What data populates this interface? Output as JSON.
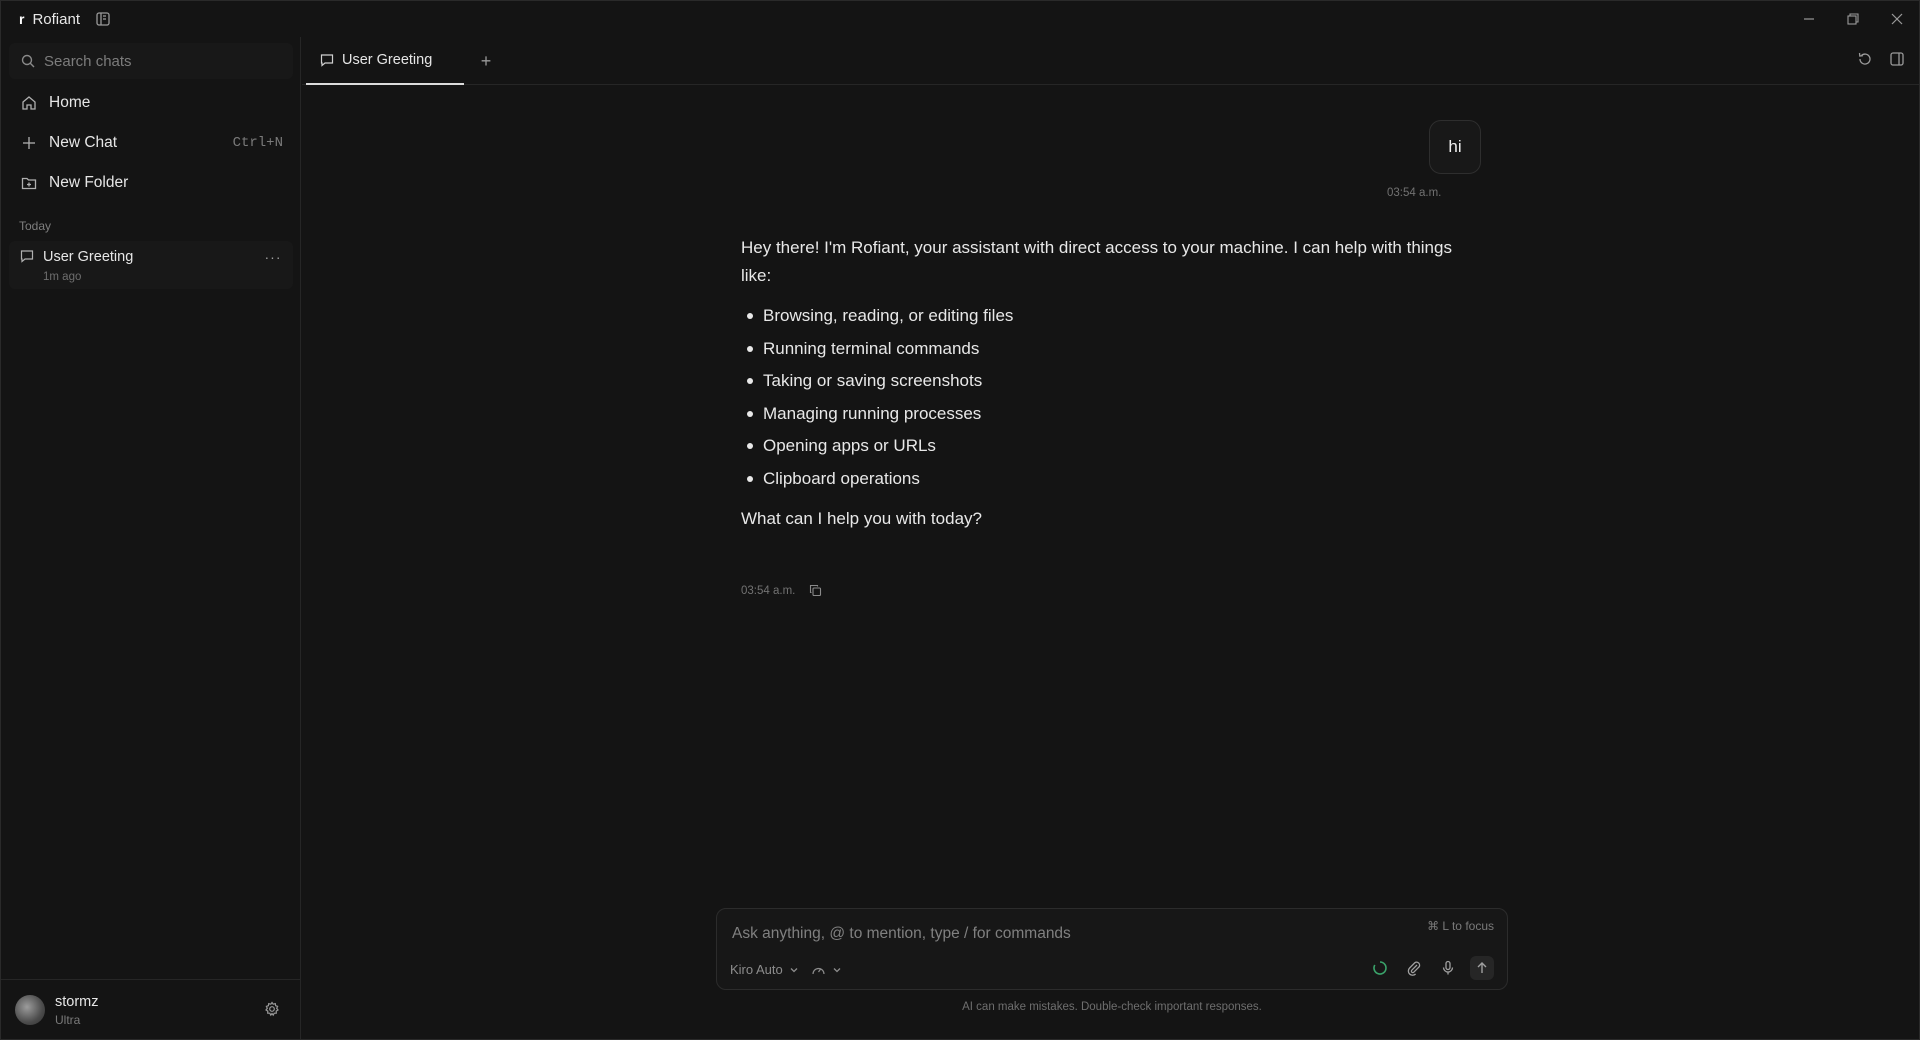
{
  "app": {
    "title": "Rofiant",
    "logo_glyph": "r"
  },
  "window_controls": {
    "minimize": "minimize-icon",
    "restore": "restore-icon",
    "close": "close-icon"
  },
  "sidebar": {
    "search": {
      "placeholder": "Search chats"
    },
    "nav": [
      {
        "label": "Home",
        "icon": "home-icon"
      },
      {
        "label": "New Chat",
        "shortcut": "Ctrl+N",
        "icon": "plus-icon"
      },
      {
        "label": "New Folder",
        "icon": "folder-plus-icon"
      }
    ],
    "section_today": "Today",
    "chats": [
      {
        "title": "User Greeting",
        "time": "1m ago",
        "more": "···"
      }
    ],
    "user": {
      "name": "stormz",
      "plan": "Ultra"
    }
  },
  "tabs": [
    {
      "label": "User Greeting",
      "icon": "chat-icon"
    }
  ],
  "tab_add": "+",
  "conversation": {
    "user_message": {
      "text": "hi",
      "time": "03:54 a.m."
    },
    "assistant_message": {
      "intro": "Hey there! I'm Rofiant, your assistant with direct access to your machine. I can help with things like:",
      "items": [
        "Browsing, reading, or editing files",
        "Running terminal commands",
        "Taking or saving screenshots",
        "Managing running processes",
        "Opening apps or URLs",
        "Clipboard operations"
      ],
      "outro": "What can I help you with today?",
      "time": "03:54 a.m."
    }
  },
  "composer": {
    "placeholder": "Ask anything, @ to mention, type / for commands",
    "focus_hint": "⌘ L to focus",
    "model": "Kiro Auto"
  },
  "disclaimer": "AI can make mistakes. Double-check important responses.",
  "colors": {
    "background": "#141414",
    "panel": "#181818",
    "accent_green": "#3aa36a",
    "text": "#e6e6e6",
    "muted": "#7a7a7a"
  }
}
